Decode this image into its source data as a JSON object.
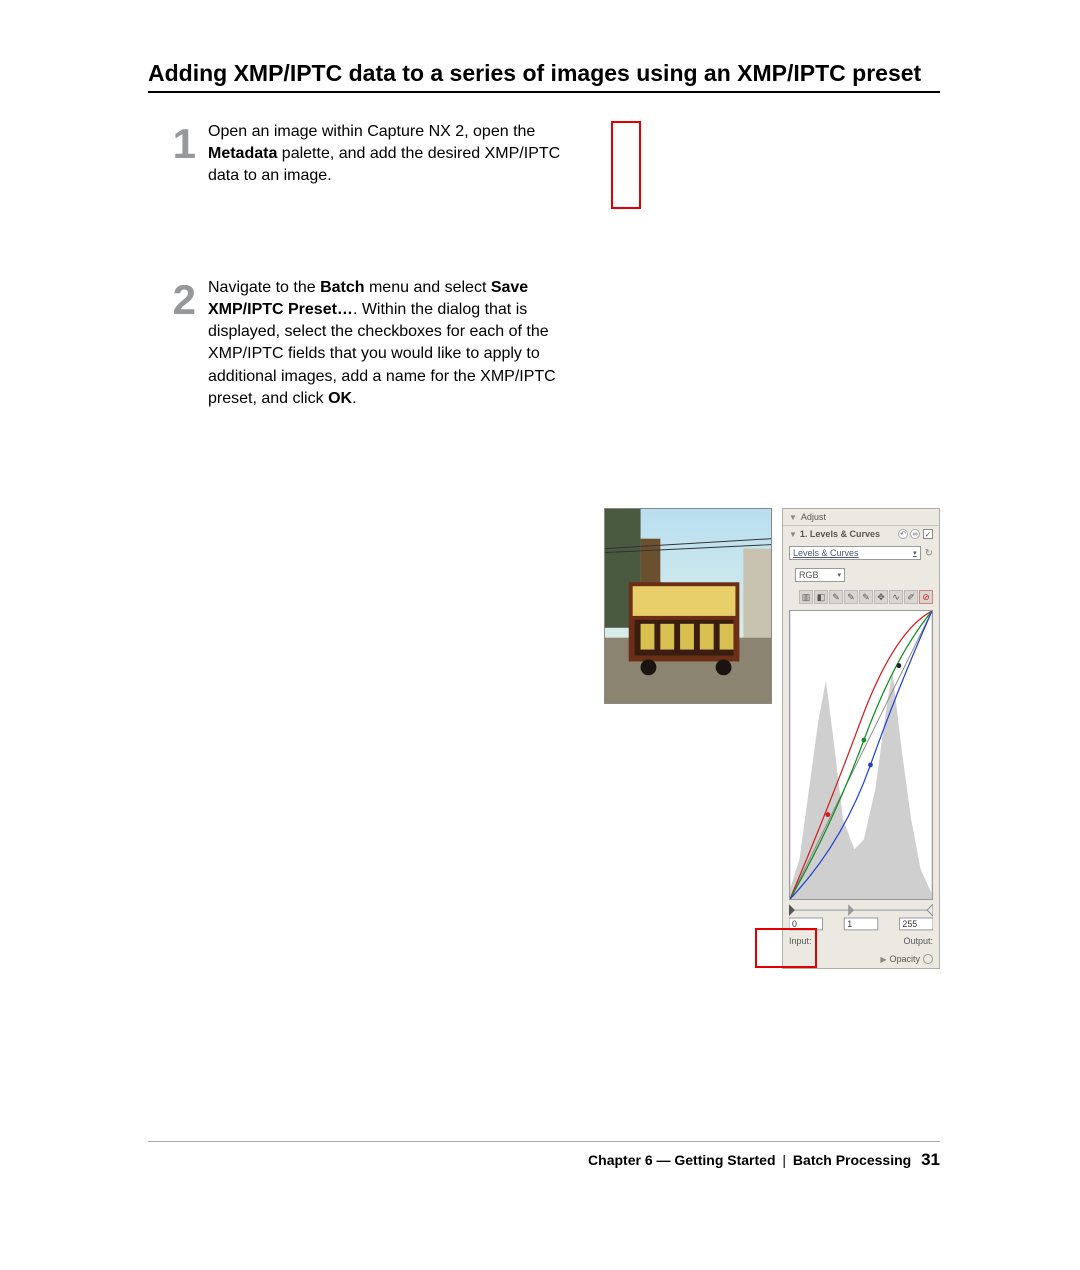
{
  "title": "Adding XMP/IPTC data to a series of images using an XMP/IPTC preset",
  "steps": {
    "s1": {
      "num": "1",
      "pre": "Open an image within Capture NX 2, open the ",
      "bold1": "Metadata",
      "post": " palette, and add the desired XMP/IPTC data to an image."
    },
    "s2": {
      "num": "2",
      "pre": "Navigate to the ",
      "bold1": "Batch",
      "mid1": " menu and select ",
      "bold2": "Save XMP/IPTC Preset…",
      "mid2": ". Within the dialog that is displayed, select the checkboxes for each of the XMP/IPTC fields that you would like to apply to additional images, add a name for the XMP/IPTC preset, and click ",
      "bold3": "OK",
      "post": "."
    }
  },
  "panel": {
    "adjust": "Adjust",
    "item1": "1. Levels & Curves",
    "preset": "Levels & Curves",
    "channel": "RGB",
    "input_label": "Input:",
    "output_label": "Output:",
    "in0": "0",
    "in1": "1",
    "in255": "255",
    "opacity": "Opacity"
  },
  "chart_data": {
    "type": "line",
    "title": "Levels & Curves histogram with RGB tone curves",
    "xlabel": "Input",
    "ylabel": "Output",
    "xlim": [
      0,
      255
    ],
    "ylim": [
      0,
      255
    ],
    "series": [
      {
        "name": "Histogram",
        "type": "area",
        "x": [
          0,
          20,
          40,
          60,
          80,
          100,
          120,
          140,
          160,
          180,
          200,
          220,
          240,
          255
        ],
        "y": [
          10,
          40,
          160,
          220,
          130,
          60,
          50,
          80,
          190,
          230,
          120,
          70,
          30,
          5
        ]
      },
      {
        "name": "Red curve",
        "x": [
          0,
          60,
          128,
          200,
          255
        ],
        "y": [
          0,
          90,
          165,
          222,
          255
        ]
      },
      {
        "name": "Green curve",
        "x": [
          0,
          60,
          128,
          200,
          255
        ],
        "y": [
          0,
          70,
          150,
          215,
          255
        ]
      },
      {
        "name": "Blue curve",
        "x": [
          0,
          60,
          128,
          200,
          255
        ],
        "y": [
          0,
          50,
          130,
          205,
          255
        ]
      },
      {
        "name": "Diagonal reference",
        "x": [
          0,
          255
        ],
        "y": [
          0,
          255
        ]
      }
    ]
  },
  "footer": {
    "chapter": "Chapter 6 — Getting Started",
    "section": "Batch Processing",
    "page": "31"
  }
}
